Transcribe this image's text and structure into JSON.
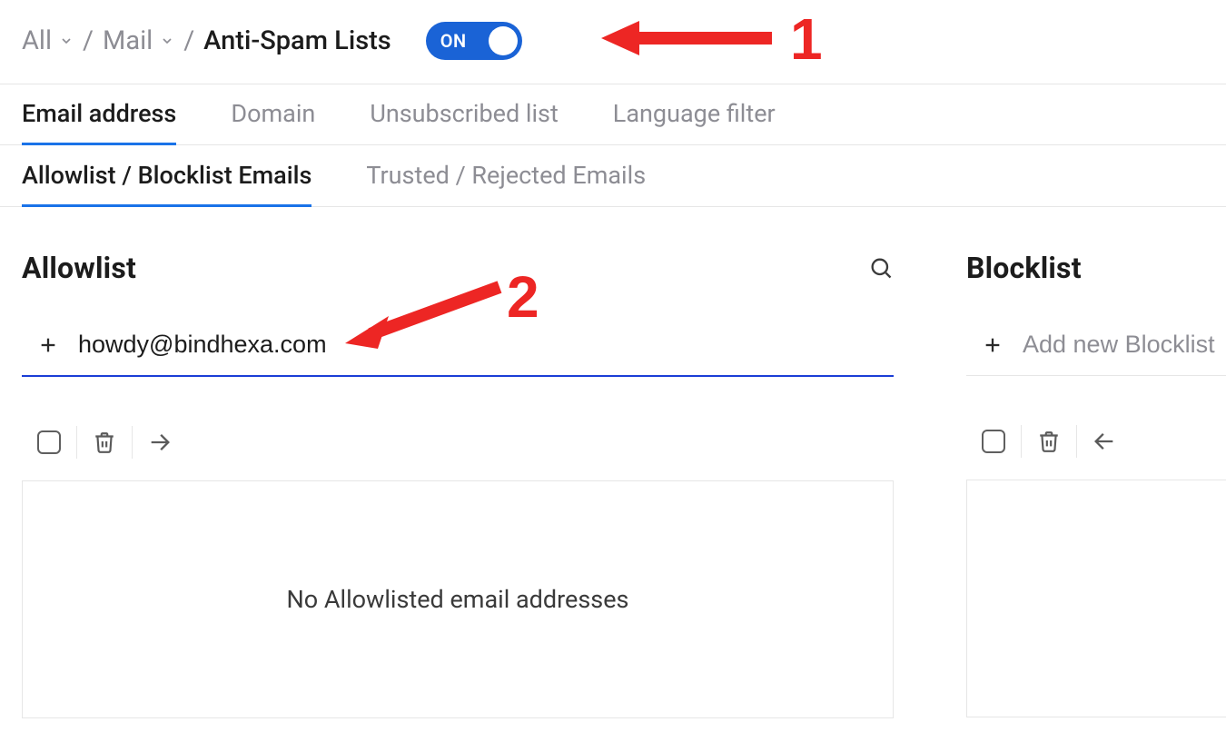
{
  "breadcrumb": {
    "root": "All",
    "mid": "Mail",
    "current": "Anti-Spam Lists"
  },
  "toggle": {
    "label": "ON"
  },
  "tabs_primary": [
    {
      "label": "Email address",
      "active": true
    },
    {
      "label": "Domain",
      "active": false
    },
    {
      "label": "Unsubscribed list",
      "active": false
    },
    {
      "label": "Language filter",
      "active": false
    }
  ],
  "tabs_secondary": [
    {
      "label": "Allowlist / Blocklist Emails",
      "active": true
    },
    {
      "label": "Trusted / Rejected Emails",
      "active": false
    }
  ],
  "allowlist": {
    "title": "Allowlist",
    "input_value": "howdy@bindhexa.com",
    "empty_message": "No Allowlisted email addresses"
  },
  "blocklist": {
    "title": "Blocklist",
    "placeholder": "Add new Blocklist"
  },
  "annotations": {
    "one": "1",
    "two": "2"
  },
  "colors": {
    "accent": "#1a73e8",
    "red": "#ed2624"
  }
}
